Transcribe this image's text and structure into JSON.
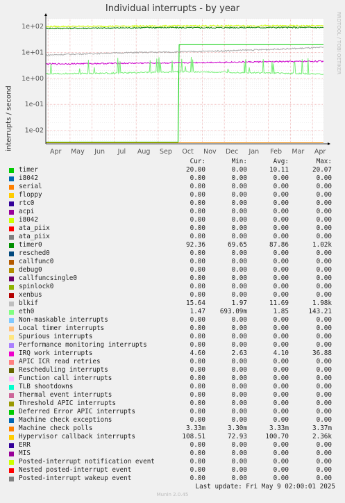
{
  "title": "Individual interrupts - by year",
  "side_text": "RRDTOOL / TOBI OETIKER",
  "footer_version": "Munin 2.0.45",
  "last_update": "Last update: Fri May  9 02:00:01 2025",
  "columns": [
    "Cur:",
    "Min:",
    "Avg:",
    "Max:"
  ],
  "chart_data": {
    "type": "line",
    "title": "Individual interrupts - by year",
    "ylabel": "interrupts / second",
    "yscale": "log",
    "ylim": [
      0.003,
      200
    ],
    "yticks": [
      "1e-02",
      "1e-01",
      "1e+00",
      "1e+01",
      "1e+02"
    ],
    "x": [
      "Apr",
      "May",
      "Jun",
      "Jul",
      "Aug",
      "Sep",
      "Oct",
      "Nov",
      "Dec",
      "Jan",
      "Feb",
      "Mar",
      "Apr"
    ],
    "grid": true,
    "series": [
      {
        "name": "timer",
        "color": "#00cc00",
        "approx": [
          [
            0,
            0.0035
          ],
          [
            6.0,
            0.0035
          ],
          [
            6.05,
            20
          ],
          [
            12.6,
            20
          ]
        ]
      },
      {
        "name": "timer0",
        "color": "#008000",
        "approx": [
          [
            0,
            85
          ],
          [
            3.0,
            88
          ],
          [
            5.0,
            92
          ],
          [
            7.0,
            90
          ],
          [
            9.0,
            92
          ],
          [
            12.6,
            92
          ]
        ]
      },
      {
        "name": "Hypervisor callback interrupts",
        "color": "#ccff00",
        "approx": [
          [
            0,
            100
          ],
          [
            4.0,
            105
          ],
          [
            8.0,
            108
          ],
          [
            12.6,
            108
          ]
        ]
      },
      {
        "name": "blkif",
        "color": "#aaaaaa",
        "approx": [
          [
            0,
            8
          ],
          [
            2.0,
            9
          ],
          [
            4.0,
            10
          ],
          [
            6.0,
            10.5
          ],
          [
            8.0,
            11.5
          ],
          [
            10.0,
            13
          ],
          [
            12.6,
            15.6
          ]
        ]
      },
      {
        "name": "IRQ work interrupts",
        "color": "#cc00cc",
        "approx": [
          [
            0,
            3.6
          ],
          [
            3.0,
            3.8
          ],
          [
            6.0,
            4.0
          ],
          [
            9.0,
            4.3
          ],
          [
            12.6,
            4.6
          ]
        ]
      },
      {
        "name": "eth0",
        "color": "#77ee77",
        "approx": [
          [
            0,
            1.5
          ],
          [
            3.0,
            1.6
          ],
          [
            6.0,
            1.8
          ],
          [
            9.0,
            1.7
          ],
          [
            12.6,
            1.47
          ]
        ]
      },
      {
        "name": "Machine check polls",
        "color": "#ee8800",
        "approx": [
          [
            0,
            0.0033
          ],
          [
            12.6,
            0.0033
          ]
        ]
      }
    ]
  },
  "legend": [
    {
      "color": "#00cc00",
      "label": "timer",
      "cur": "20.00",
      "min": "0.00",
      "avg": "10.11",
      "max": "20.07"
    },
    {
      "color": "#0066b3",
      "label": "i8042",
      "cur": "0.00",
      "min": "0.00",
      "avg": "0.00",
      "max": "0.00"
    },
    {
      "color": "#ff8000",
      "label": "serial",
      "cur": "0.00",
      "min": "0.00",
      "avg": "0.00",
      "max": "0.00"
    },
    {
      "color": "#ffcc00",
      "label": "floppy",
      "cur": "0.00",
      "min": "0.00",
      "avg": "0.00",
      "max": "0.00"
    },
    {
      "color": "#330099",
      "label": "rtc0",
      "cur": "0.00",
      "min": "0.00",
      "avg": "0.00",
      "max": "0.00"
    },
    {
      "color": "#990099",
      "label": "acpi",
      "cur": "0.00",
      "min": "0.00",
      "avg": "0.00",
      "max": "0.00"
    },
    {
      "color": "#ccff00",
      "label": "i8042",
      "cur": "0.00",
      "min": "0.00",
      "avg": "0.00",
      "max": "0.00"
    },
    {
      "color": "#ff0000",
      "label": "ata_piix",
      "cur": "0.00",
      "min": "0.00",
      "avg": "0.00",
      "max": "0.00"
    },
    {
      "color": "#808080",
      "label": "ata_piix",
      "cur": "0.00",
      "min": "0.00",
      "avg": "0.00",
      "max": "0.00"
    },
    {
      "color": "#008f00",
      "label": "timer0",
      "cur": "92.36",
      "min": "69.65",
      "avg": "87.86",
      "max": "1.02k"
    },
    {
      "color": "#00487d",
      "label": "resched0",
      "cur": "0.00",
      "min": "0.00",
      "avg": "0.00",
      "max": "0.00"
    },
    {
      "color": "#b35a00",
      "label": "callfunc0",
      "cur": "0.00",
      "min": "0.00",
      "avg": "0.00",
      "max": "0.00"
    },
    {
      "color": "#b38f00",
      "label": "debug0",
      "cur": "0.00",
      "min": "0.00",
      "avg": "0.00",
      "max": "0.00"
    },
    {
      "color": "#6b006b",
      "label": "callfuncsingle0",
      "cur": "0.00",
      "min": "0.00",
      "avg": "0.00",
      "max": "0.00"
    },
    {
      "color": "#8fb300",
      "label": "spinlock0",
      "cur": "0.00",
      "min": "0.00",
      "avg": "0.00",
      "max": "0.00"
    },
    {
      "color": "#b30000",
      "label": "xenbus",
      "cur": "0.00",
      "min": "0.00",
      "avg": "0.00",
      "max": "0.00"
    },
    {
      "color": "#bebebe",
      "label": "blkif",
      "cur": "15.64",
      "min": "1.97",
      "avg": "11.69",
      "max": "1.98k"
    },
    {
      "color": "#80ff80",
      "label": "eth0",
      "cur": "1.47",
      "min": "693.09m",
      "avg": "1.85",
      "max": "143.21"
    },
    {
      "color": "#80c9ff",
      "label": "Non-maskable interrupts",
      "cur": "0.00",
      "min": "0.00",
      "avg": "0.00",
      "max": "0.00"
    },
    {
      "color": "#ffc080",
      "label": "Local timer interrupts",
      "cur": "0.00",
      "min": "0.00",
      "avg": "0.00",
      "max": "0.00"
    },
    {
      "color": "#ffe680",
      "label": "Spurious interrupts",
      "cur": "0.00",
      "min": "0.00",
      "avg": "0.00",
      "max": "0.00"
    },
    {
      "color": "#aa80ff",
      "label": "Performance monitoring interrupts",
      "cur": "0.00",
      "min": "0.00",
      "avg": "0.00",
      "max": "0.00"
    },
    {
      "color": "#ee00cc",
      "label": "IRQ work interrupts",
      "cur": "4.60",
      "min": "2.63",
      "avg": "4.10",
      "max": "36.88"
    },
    {
      "color": "#ff8080",
      "label": "APIC ICR read retries",
      "cur": "0.00",
      "min": "0.00",
      "avg": "0.00",
      "max": "0.00"
    },
    {
      "color": "#666600",
      "label": "Rescheduling interrupts",
      "cur": "0.00",
      "min": "0.00",
      "avg": "0.00",
      "max": "0.00"
    },
    {
      "color": "#ffbfff",
      "label": "Function call interrupts",
      "cur": "0.00",
      "min": "0.00",
      "avg": "0.00",
      "max": "0.00"
    },
    {
      "color": "#00ffcc",
      "label": "TLB shootdowns",
      "cur": "0.00",
      "min": "0.00",
      "avg": "0.00",
      "max": "0.00"
    },
    {
      "color": "#cc6699",
      "label": "Thermal event interrupts",
      "cur": "0.00",
      "min": "0.00",
      "avg": "0.00",
      "max": "0.00"
    },
    {
      "color": "#999900",
      "label": "Threshold APIC interrupts",
      "cur": "0.00",
      "min": "0.00",
      "avg": "0.00",
      "max": "0.00"
    },
    {
      "color": "#00cc00",
      "label": "Deferred Error APIC interrupts",
      "cur": "0.00",
      "min": "0.00",
      "avg": "0.00",
      "max": "0.00"
    },
    {
      "color": "#0066b3",
      "label": "Machine check exceptions",
      "cur": "0.00",
      "min": "0.00",
      "avg": "0.00",
      "max": "0.00"
    },
    {
      "color": "#ff8000",
      "label": "Machine check polls",
      "cur": "3.33m",
      "min": "3.30m",
      "avg": "3.33m",
      "max": "3.37m"
    },
    {
      "color": "#ffcc00",
      "label": "Hypervisor callback interrupts",
      "cur": "108.51",
      "min": "72.93",
      "avg": "100.70",
      "max": "2.36k"
    },
    {
      "color": "#330099",
      "label": "ERR",
      "cur": "0.00",
      "min": "0.00",
      "avg": "0.00",
      "max": "0.00"
    },
    {
      "color": "#990099",
      "label": "MIS",
      "cur": "0.00",
      "min": "0.00",
      "avg": "0.00",
      "max": "0.00"
    },
    {
      "color": "#ccff00",
      "label": "Posted-interrupt notification event",
      "cur": "0.00",
      "min": "0.00",
      "avg": "0.00",
      "max": "0.00"
    },
    {
      "color": "#ff0000",
      "label": "Nested posted-interrupt event",
      "cur": "0.00",
      "min": "0.00",
      "avg": "0.00",
      "max": "0.00"
    },
    {
      "color": "#808080",
      "label": "Posted-interrupt wakeup event",
      "cur": "0.00",
      "min": "0.00",
      "avg": "0.00",
      "max": "0.00"
    }
  ]
}
